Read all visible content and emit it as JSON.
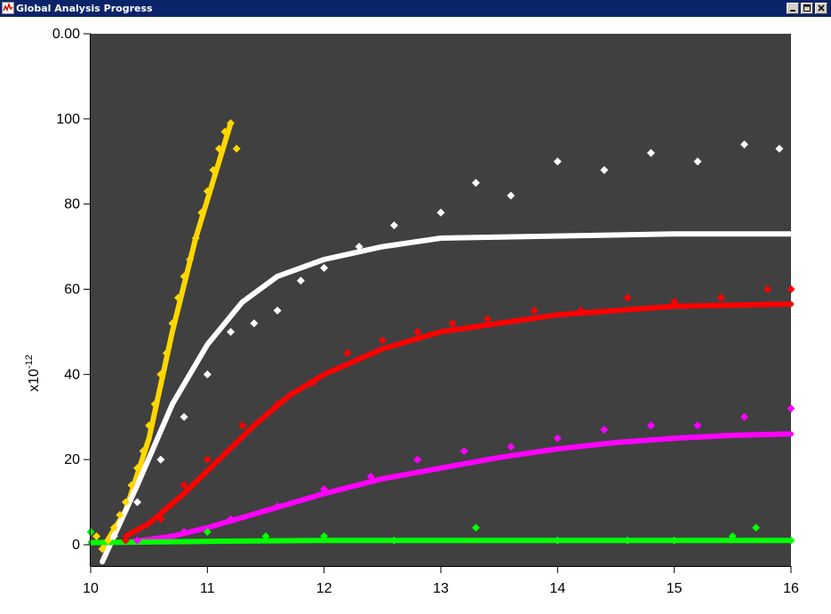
{
  "window": {
    "title": "Global Analysis Progress",
    "icons": [
      "chart-app-icon",
      "minimize-icon",
      "maximize-icon",
      "close-icon"
    ]
  },
  "chart_data": {
    "type": "scatter",
    "title": "",
    "xlabel": "",
    "ylabel": "x10-12",
    "y_multiplier_label": {
      "base": "x10",
      "exponent": "-12"
    },
    "xlim": [
      10,
      16
    ],
    "ylim": [
      -5,
      120
    ],
    "x_ticks": [
      10,
      11,
      12,
      13,
      14,
      15,
      16
    ],
    "x_tick_labels": [
      "10",
      "11",
      "12",
      "13",
      "14",
      "15",
      "16"
    ],
    "y_ticks": [
      0,
      20,
      40,
      60,
      80,
      100,
      120
    ],
    "y_tick_labels": [
      "0",
      "20",
      "40",
      "60",
      "80",
      "100",
      "0.00"
    ],
    "plot_background": "#404040",
    "grid": false,
    "legend": "none",
    "series": [
      {
        "color": "#ffd700",
        "marker": "diamond",
        "points": [
          [
            10.05,
            2
          ],
          [
            10.1,
            -1
          ],
          [
            10.15,
            1
          ],
          [
            10.2,
            4
          ],
          [
            10.25,
            7
          ],
          [
            10.3,
            10
          ],
          [
            10.35,
            14
          ],
          [
            10.4,
            18
          ],
          [
            10.45,
            22
          ],
          [
            10.5,
            28
          ],
          [
            10.55,
            33
          ],
          [
            10.6,
            40
          ],
          [
            10.65,
            45
          ],
          [
            10.7,
            52
          ],
          [
            10.75,
            58
          ],
          [
            10.8,
            63
          ],
          [
            10.85,
            67
          ],
          [
            10.9,
            72
          ],
          [
            10.95,
            78
          ],
          [
            11.0,
            83
          ],
          [
            11.05,
            88
          ],
          [
            11.1,
            93
          ],
          [
            11.15,
            97
          ],
          [
            11.2,
            99
          ],
          [
            11.25,
            93
          ]
        ],
        "fit": [
          [
            10.1,
            -1
          ],
          [
            10.3,
            8
          ],
          [
            10.5,
            25
          ],
          [
            10.7,
            50
          ],
          [
            10.9,
            72
          ],
          [
            11.1,
            90
          ],
          [
            11.2,
            99
          ]
        ]
      },
      {
        "color": "#ffffff",
        "marker": "diamond",
        "points": [
          [
            10.2,
            2
          ],
          [
            10.4,
            10
          ],
          [
            10.6,
            20
          ],
          [
            10.8,
            30
          ],
          [
            11.0,
            40
          ],
          [
            11.2,
            50
          ],
          [
            11.4,
            52
          ],
          [
            11.6,
            55
          ],
          [
            11.8,
            62
          ],
          [
            12.0,
            65
          ],
          [
            12.3,
            70
          ],
          [
            12.6,
            75
          ],
          [
            13.0,
            78
          ],
          [
            13.3,
            85
          ],
          [
            13.6,
            82
          ],
          [
            14.0,
            90
          ],
          [
            14.4,
            88
          ],
          [
            14.8,
            92
          ],
          [
            15.2,
            90
          ],
          [
            15.6,
            94
          ],
          [
            15.9,
            93
          ]
        ],
        "fit": [
          [
            10.1,
            -4
          ],
          [
            10.4,
            14
          ],
          [
            10.7,
            33
          ],
          [
            11.0,
            47
          ],
          [
            11.3,
            57
          ],
          [
            11.6,
            63
          ],
          [
            12.0,
            67
          ],
          [
            12.5,
            70
          ],
          [
            13.0,
            72
          ],
          [
            14.0,
            72.5
          ],
          [
            15.0,
            73
          ],
          [
            16.0,
            73
          ]
        ]
      },
      {
        "color": "#ff0000",
        "marker": "diamond",
        "points": [
          [
            10.3,
            1
          ],
          [
            10.6,
            6
          ],
          [
            10.8,
            14
          ],
          [
            11.0,
            20
          ],
          [
            11.3,
            28
          ],
          [
            11.6,
            33
          ],
          [
            11.9,
            38
          ],
          [
            12.2,
            45
          ],
          [
            12.5,
            48
          ],
          [
            12.8,
            50
          ],
          [
            13.1,
            52
          ],
          [
            13.4,
            53
          ],
          [
            13.8,
            55
          ],
          [
            14.2,
            55
          ],
          [
            14.6,
            58
          ],
          [
            15.0,
            57
          ],
          [
            15.4,
            58
          ],
          [
            15.8,
            60
          ],
          [
            16.0,
            60
          ]
        ],
        "fit": [
          [
            10.3,
            2
          ],
          [
            10.5,
            5
          ],
          [
            10.8,
            12
          ],
          [
            11.1,
            20
          ],
          [
            11.4,
            28
          ],
          [
            11.7,
            35
          ],
          [
            12.0,
            40
          ],
          [
            12.5,
            46
          ],
          [
            13.0,
            50
          ],
          [
            13.5,
            52
          ],
          [
            14.0,
            54
          ],
          [
            15.0,
            56
          ],
          [
            16.0,
            56.5
          ]
        ]
      },
      {
        "color": "#ff00ff",
        "marker": "diamond",
        "points": [
          [
            10.4,
            1
          ],
          [
            10.8,
            3
          ],
          [
            11.2,
            6
          ],
          [
            11.6,
            9
          ],
          [
            12.0,
            13
          ],
          [
            12.4,
            16
          ],
          [
            12.8,
            20
          ],
          [
            13.2,
            22
          ],
          [
            13.6,
            23
          ],
          [
            14.0,
            25
          ],
          [
            14.4,
            27
          ],
          [
            14.8,
            28
          ],
          [
            15.2,
            28
          ],
          [
            15.6,
            30
          ],
          [
            16.0,
            32
          ]
        ],
        "fit": [
          [
            10.3,
            0.5
          ],
          [
            10.7,
            2
          ],
          [
            11.0,
            4
          ],
          [
            11.5,
            8
          ],
          [
            12.0,
            12
          ],
          [
            12.5,
            15.5
          ],
          [
            13.0,
            18
          ],
          [
            13.5,
            20.5
          ],
          [
            14.0,
            22.5
          ],
          [
            14.5,
            24
          ],
          [
            15.0,
            25
          ],
          [
            15.5,
            25.7
          ],
          [
            16.0,
            26
          ]
        ]
      },
      {
        "color": "#00ff00",
        "marker": "diamond",
        "points": [
          [
            10.0,
            3
          ],
          [
            11.0,
            3
          ],
          [
            11.5,
            2
          ],
          [
            12.0,
            2
          ],
          [
            12.6,
            1
          ],
          [
            13.3,
            4
          ],
          [
            14.0,
            1
          ],
          [
            14.6,
            1
          ],
          [
            15.0,
            1
          ],
          [
            15.5,
            2
          ],
          [
            15.7,
            4
          ],
          [
            16.0,
            1
          ]
        ],
        "fit": [
          [
            10.0,
            0.5
          ],
          [
            11.0,
            0.8
          ],
          [
            12.0,
            1
          ],
          [
            13.0,
            1
          ],
          [
            14.0,
            1
          ],
          [
            15.0,
            1
          ],
          [
            16.0,
            1
          ]
        ]
      }
    ]
  }
}
